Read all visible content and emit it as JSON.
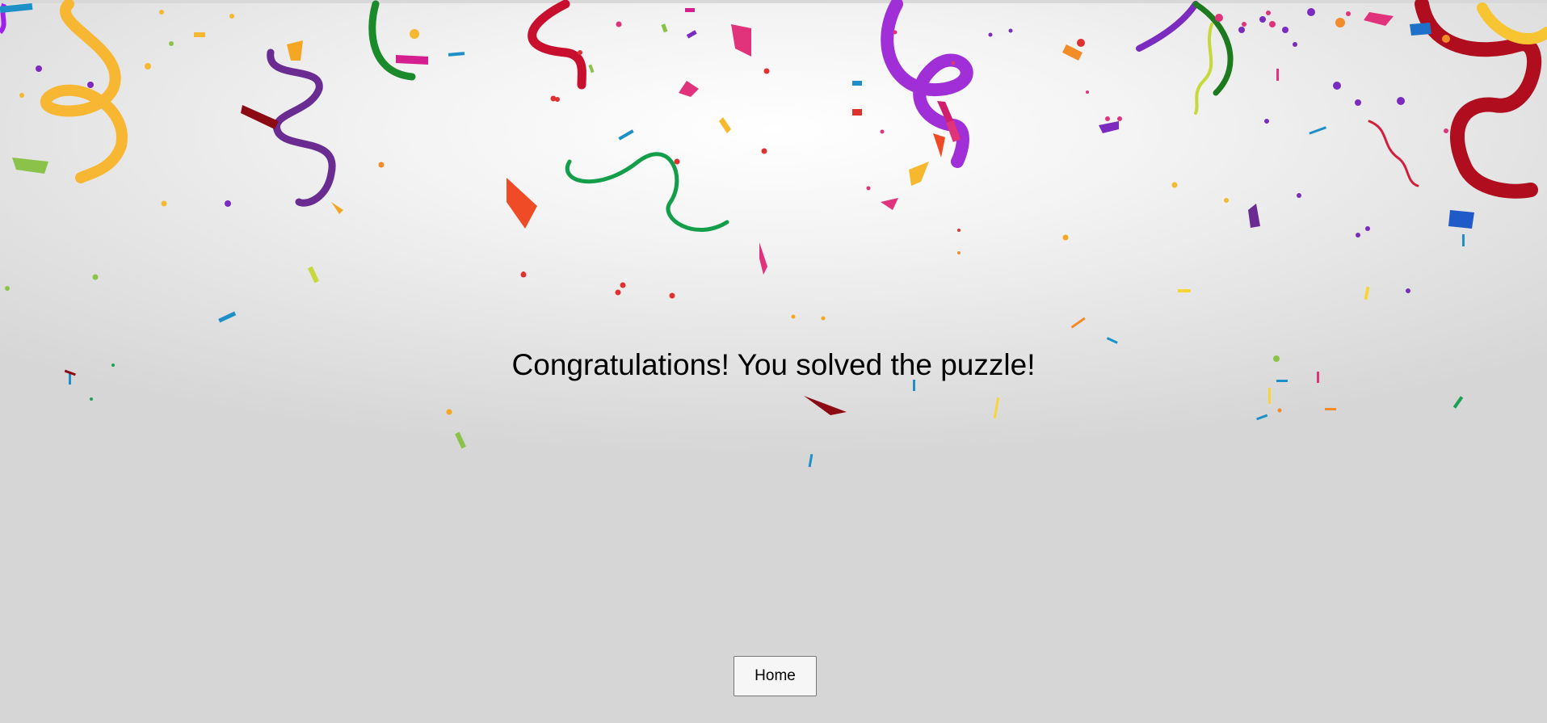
{
  "message": "Congratulations! You solved the puzzle!",
  "home_label": "Home",
  "colors": {
    "background": "#e6e6e6",
    "confetti": [
      "#f5b82e",
      "#7b2cbf",
      "#c40f1a",
      "#1f9e55",
      "#1e90c8",
      "#e0337c",
      "#9acd32",
      "#f26c1a",
      "#2a5bd7",
      "#a020f0"
    ]
  }
}
